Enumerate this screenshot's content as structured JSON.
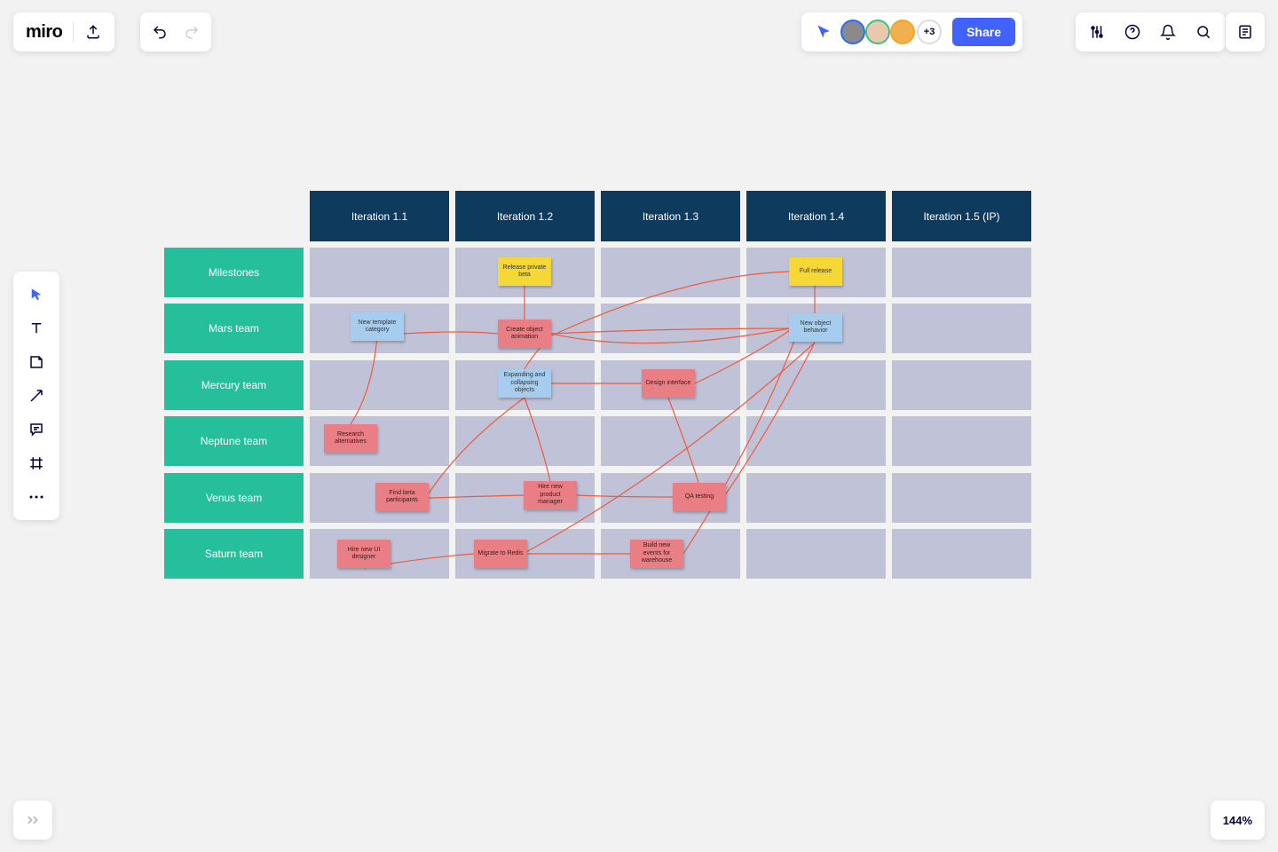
{
  "app": {
    "name": "miro"
  },
  "header": {
    "present_indicator": "arrow",
    "avatars": [
      "user-1",
      "user-2",
      "user-3"
    ],
    "extra_count": "+3",
    "share_label": "Share"
  },
  "zoom": {
    "value": "144%"
  },
  "grid": {
    "columns": [
      "Iteration 1.1",
      "Iteration 1.2",
      "Iteration 1.3",
      "Iteration 1.4",
      "Iteration 1.5 (IP)"
    ],
    "rows": [
      "Milestones",
      "Mars team",
      "Mercury team",
      "Neptune team",
      "Venus team",
      "Saturn team"
    ]
  },
  "stickies": {
    "release_beta": "Release private beta",
    "full_release": "Full release",
    "new_template": "New template category",
    "create_anim": "Create object animation",
    "new_obj_behavior": "New object behavior",
    "expanding": "Expanding and collapsing objects",
    "design_iface": "Design interface",
    "research_alt": "Research alternatives",
    "find_beta": "Find beta participants",
    "hire_pm": "Hire new product manager",
    "qa_testing": "QA testing",
    "hire_ui": "Hire new UI designer",
    "migrate_redis": "Migrate to Redis",
    "build_events": "Build new events for warehouse"
  }
}
